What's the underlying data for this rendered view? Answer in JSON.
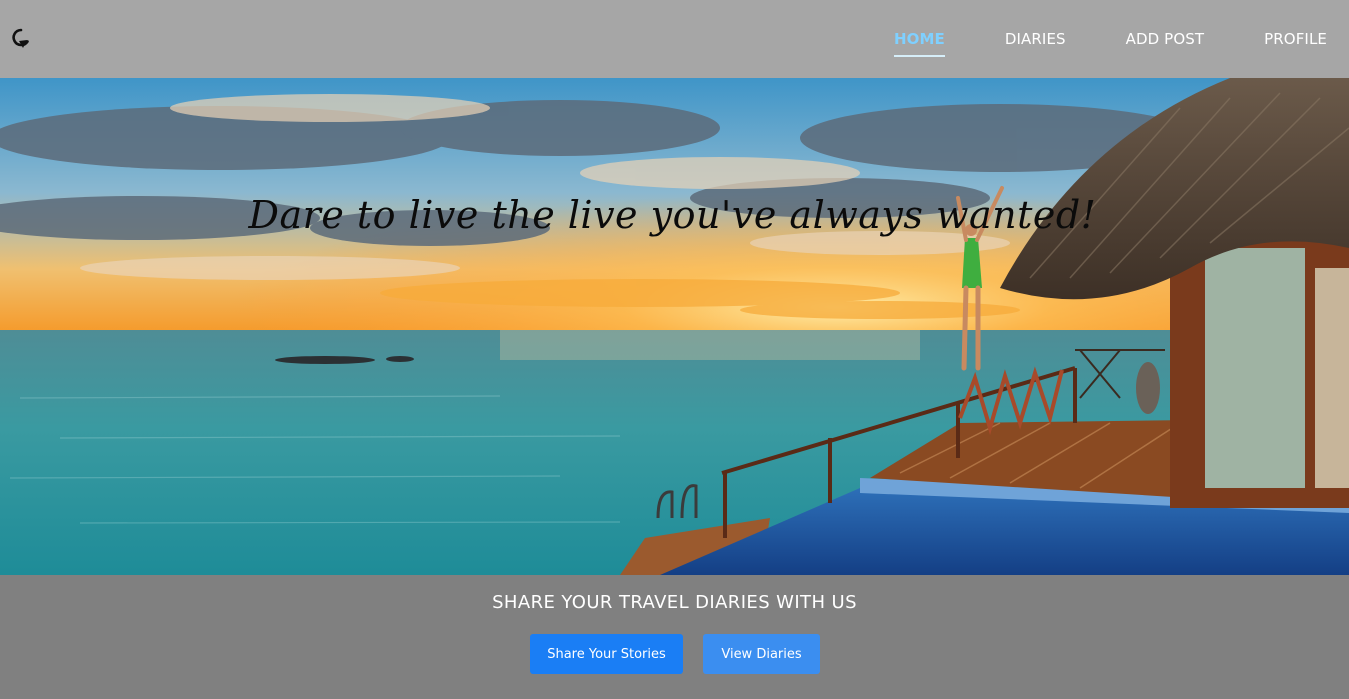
{
  "nav": {
    "logo_icon": "location-pin-icon",
    "links": [
      {
        "label": "HOME",
        "active": true
      },
      {
        "label": "DIARIES",
        "active": false
      },
      {
        "label": "ADD POST",
        "active": false
      },
      {
        "label": "PROFILE",
        "active": false
      }
    ]
  },
  "hero": {
    "tagline": "Dare to live the live you've always wanted!"
  },
  "cta": {
    "title": "SHARE YOUR TRAVEL DIARIES WITH US",
    "share_button": "Share Your Stories",
    "view_button": "View Diaries"
  },
  "colors": {
    "nav_background": "#a6a6a6",
    "active_link": "#7fd0ff",
    "bottom_background": "#808080",
    "primary_button": "#1a7ef5",
    "secondary_button": "#3b8ef0"
  }
}
